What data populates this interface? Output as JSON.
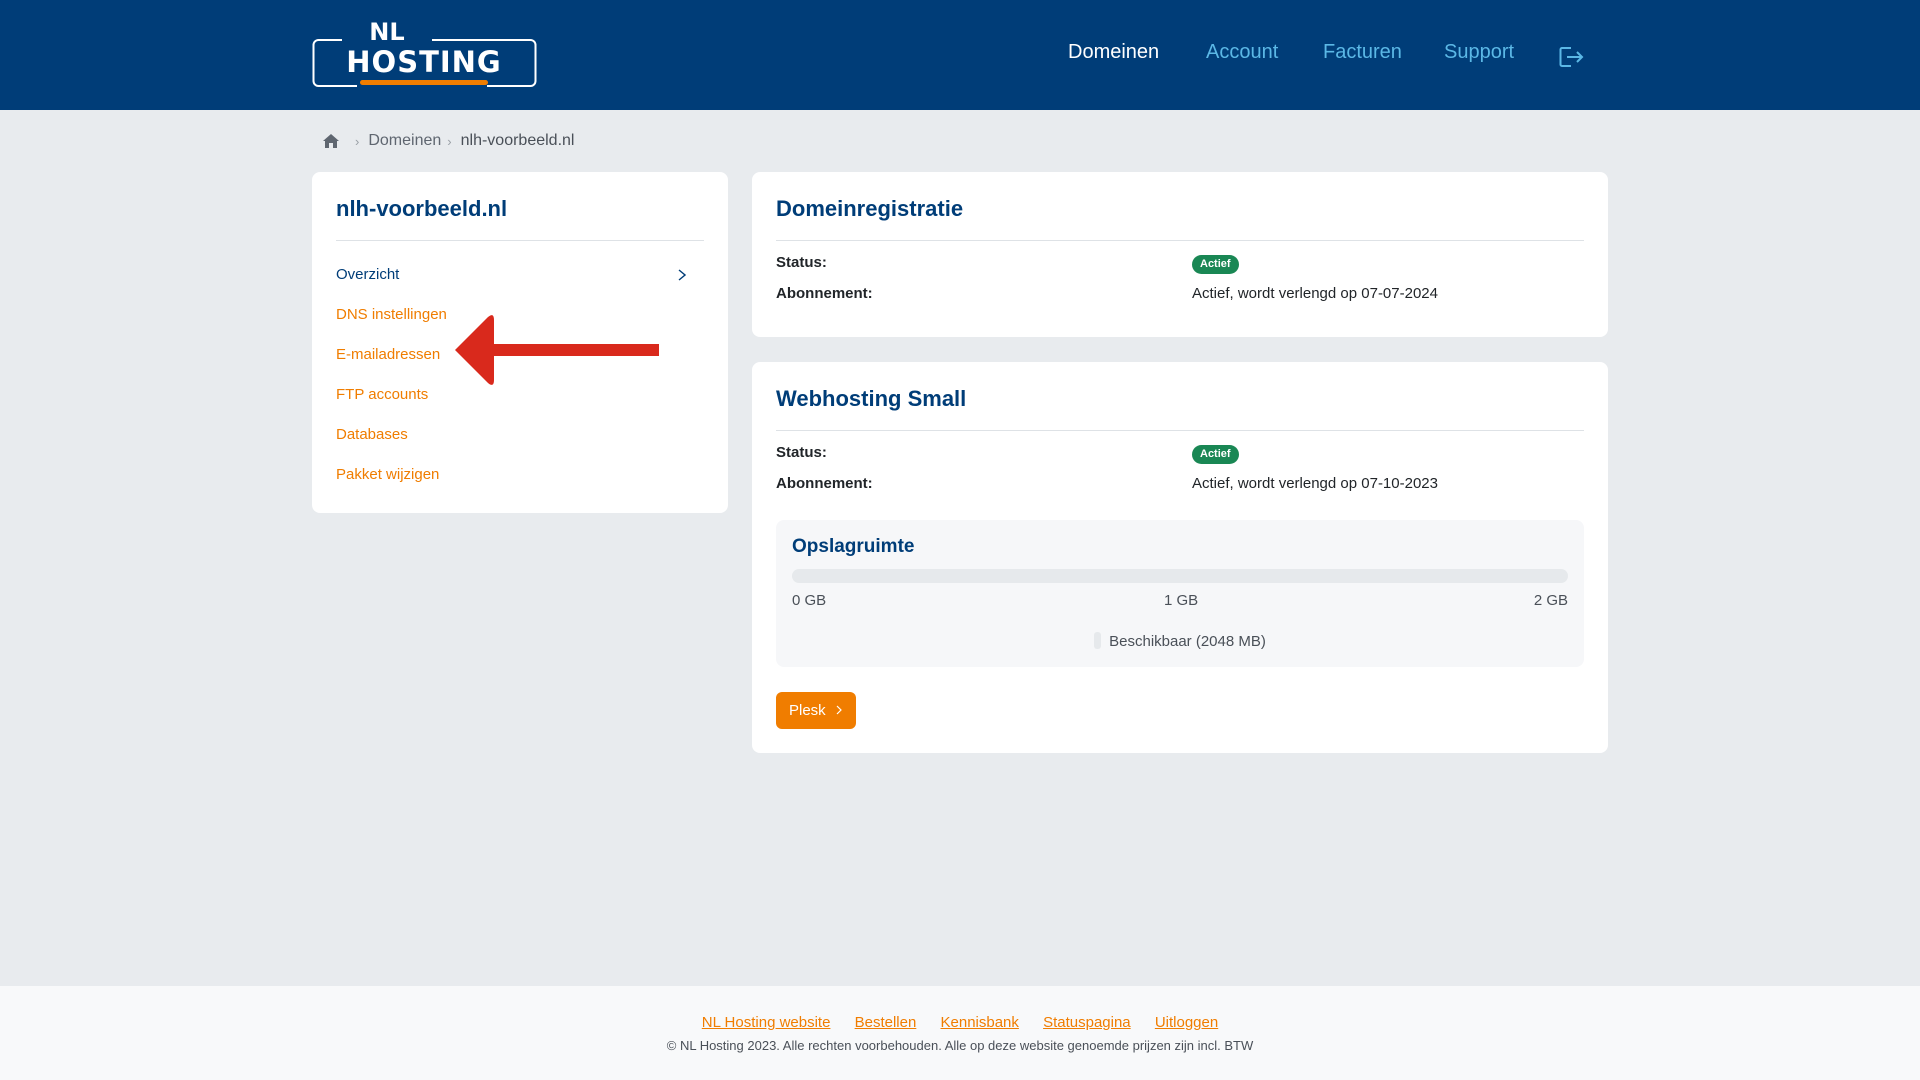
{
  "header": {
    "logo": {
      "line1": "NL",
      "line2": "HOSTING"
    },
    "nav": [
      {
        "label": "Domeinen",
        "active": true
      },
      {
        "label": "Account",
        "active": false
      },
      {
        "label": "Facturen",
        "active": false
      },
      {
        "label": "Support",
        "active": false
      }
    ],
    "logout_icon": "logout-icon"
  },
  "breadcrumb": {
    "home_icon": "home-icon",
    "items": [
      "Domeinen",
      "nlh-voorbeeld.nl"
    ]
  },
  "sidebar": {
    "title": "nlh-voorbeeld.nl",
    "items": [
      {
        "label": "Overzicht",
        "active": true
      },
      {
        "label": "DNS instellingen",
        "active": false
      },
      {
        "label": "E-mailadressen",
        "active": false
      },
      {
        "label": "FTP accounts",
        "active": false
      },
      {
        "label": "Databases",
        "active": false
      },
      {
        "label": "Pakket wijzigen",
        "active": false
      }
    ]
  },
  "annotation": {
    "type": "red-arrow",
    "points_to": "E-mailadressen",
    "color": "#d9291c"
  },
  "domain_card": {
    "title": "Domeinregistratie",
    "status_label": "Status:",
    "status_value": "Actief",
    "subscription_label": "Abonnement:",
    "subscription_value": "Actief, wordt verlengd op 07-07-2024"
  },
  "hosting_card": {
    "title": "Webhosting Small",
    "status_label": "Status:",
    "status_value": "Actief",
    "subscription_label": "Abonnement:",
    "subscription_value": "Actief, wordt verlengd op 07-10-2023",
    "storage": {
      "title": "Opslagruimte",
      "used_fraction": 0,
      "ticks": [
        "0 GB",
        "1 GB",
        "2 GB"
      ],
      "legend": "Beschikbaar (2048 MB)"
    },
    "plesk_button": "Plesk"
  },
  "footer": {
    "links": [
      "NL Hosting website",
      "Bestellen",
      "Kennisbank",
      "Statuspagina",
      "Uitloggen"
    ],
    "copyright": "© NL Hosting 2023. Alle rechten voorbehouden. Alle op deze website genoemde prijzen zijn incl. BTW"
  },
  "colors": {
    "header_bg": "#003d78",
    "accent_orange": "#f07d00",
    "nav_link": "#5bb8e6",
    "badge_green": "#198754",
    "page_bg": "#e8ebee"
  }
}
